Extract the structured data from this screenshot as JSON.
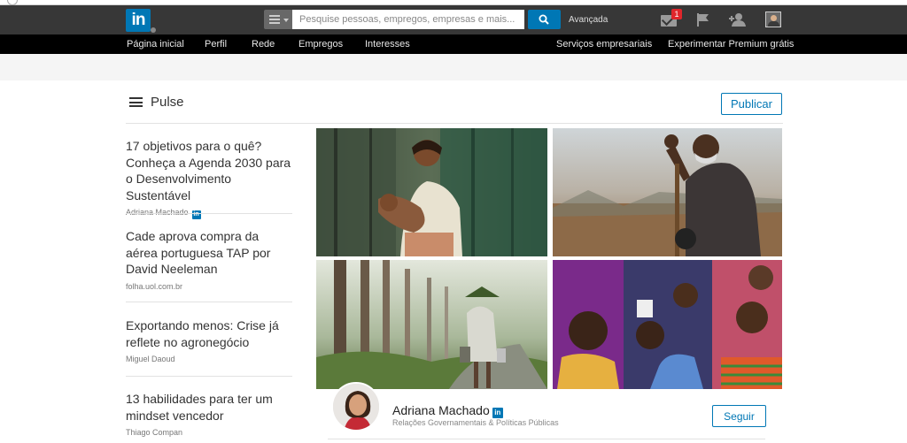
{
  "header": {
    "logo_text": "in",
    "search_placeholder": "Pesquise pessoas, empregos, empresas e mais...",
    "advanced_label": "Avançada",
    "messages_count": "1",
    "icons": [
      "search-icon",
      "mail-icon",
      "flag-icon",
      "add-connection-icon",
      "profile-avatar"
    ]
  },
  "nav": {
    "items": [
      "Página inicial",
      "Perfil",
      "Rede",
      "Empregos",
      "Interesses"
    ],
    "right_items": [
      "Serviços empresariais",
      "Experimentar Premium grátis"
    ]
  },
  "pulse": {
    "title": "Pulse",
    "publish_label": "Publicar"
  },
  "articles": [
    {
      "title": "17 objetivos para o quê? Conheça a Agenda 2030 para o Desenvolvimento Sustentável",
      "author": "Adriana Machado",
      "linkedin_badge": "in"
    },
    {
      "title": "Cade aprova compra da aérea portuguesa TAP por David Neeleman",
      "author": "folha.uol.com.br"
    },
    {
      "title": "Exportando menos: Crise já reflete no agronegócio",
      "author": "Miguel Daoud"
    },
    {
      "title": "13 habilidades para ter um mindset vencedor",
      "author": "Thiago Compan"
    }
  ],
  "featured": {
    "author_name": "Adriana Machado",
    "author_badge": "in",
    "author_role": "Relações Governamentais & Políticas Públicas",
    "follow_label": "Seguir"
  },
  "colors": {
    "brand": "#0077b5",
    "topbar": "#373737",
    "subnav": "#000000",
    "badge": "#e0262b"
  }
}
